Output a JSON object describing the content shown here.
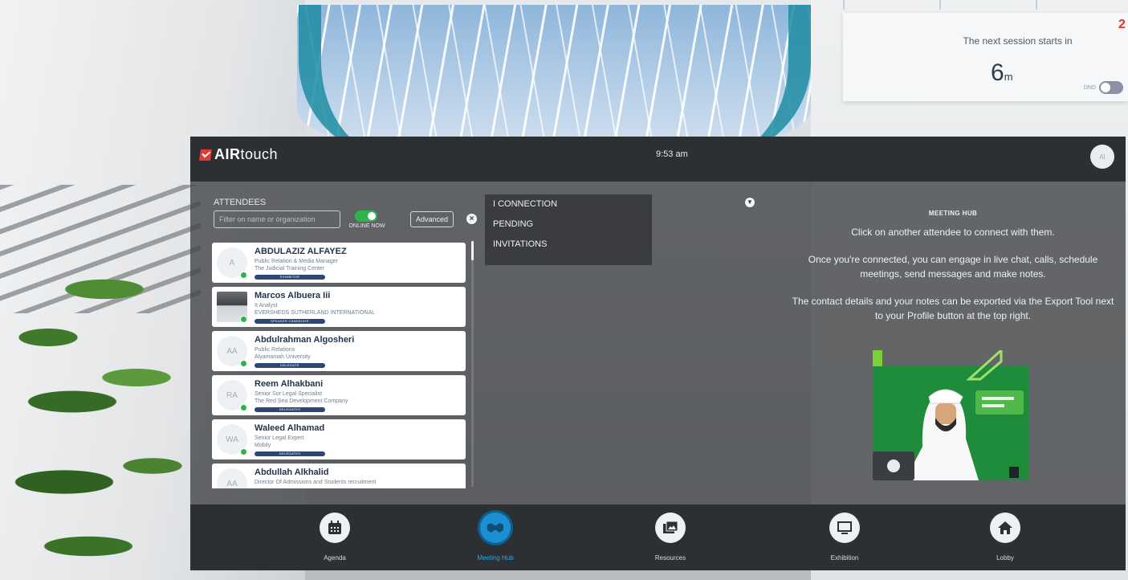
{
  "next_session": {
    "label": "The next session starts in",
    "value": "6",
    "unit": "m",
    "dnd_label": "DND",
    "dnd_on": false,
    "alert_mark": "2"
  },
  "topbar": {
    "brand_bold": "AIR",
    "brand_rest": "touch",
    "time": "9:53 am",
    "avatar_initials": "AI"
  },
  "attendees": {
    "title": "ATTENDEES",
    "filter_placeholder": "Filter on name or organization",
    "online_label": "ONLINE NOW",
    "online_on": true,
    "advanced_label": "Advanced",
    "list": [
      {
        "initials": "A",
        "name": "ABDULAZIZ ALFAYEZ",
        "title": "Public Relation & Media Manager",
        "org": "The Judicial Training Center",
        "tag": "EXHIBITOR",
        "photo": false
      },
      {
        "initials": "",
        "name": "Marcos Albuera Iii",
        "title": "It Analyst",
        "org": "EVERSHEDS SUTHERLAND INTERNATIONAL",
        "tag": "SPEAKER CANDIDATE",
        "photo": true
      },
      {
        "initials": "AA",
        "name": "Abdulrahman Algosheri",
        "title": "Public Relations",
        "org": "Alyamamah University",
        "tag": "DELEGATE",
        "photo": false
      },
      {
        "initials": "RA",
        "name": "Reem Alhakbani",
        "title": "Senior Sor Legal Specialist",
        "org": "The Red Sea Development Company",
        "tag": "DELEGATES",
        "photo": false
      },
      {
        "initials": "WA",
        "name": "Waleed Alhamad",
        "title": "Senior Legal Expert",
        "org": "Mobily",
        "tag": "DELEGATES",
        "photo": false
      },
      {
        "initials": "AA",
        "name": "Abdullah Alkhalid",
        "title": "Director Of Admissions and Students recruitment",
        "org": "",
        "tag": "",
        "photo": false
      }
    ]
  },
  "connections": {
    "items": [
      "I CONNECTION",
      "PENDING",
      "INVITATIONS"
    ]
  },
  "hub": {
    "heading": "MEETING HUB",
    "p1": "Click on another attendee to connect with them.",
    "p2": "Once you're connected, you can engage in live chat, calls, schedule meetings, send messages and make notes.",
    "p3": "The contact details and your notes can be exported via the Export Tool next to your Profile button at the top right."
  },
  "nav": [
    {
      "label": "Agenda",
      "icon": "calendar-icon",
      "active": false
    },
    {
      "label": "Meeting Hub",
      "icon": "handshake-icon",
      "active": true
    },
    {
      "label": "Resources",
      "icon": "resources-icon",
      "active": false
    },
    {
      "label": "Exhibition",
      "icon": "monitor-icon",
      "active": false
    },
    {
      "label": "Lobby",
      "icon": "home-icon",
      "active": false
    }
  ],
  "colors": {
    "accent": "#1d8fd0",
    "online": "#2eb34a",
    "brand_red": "#e13b36",
    "bar": "#2c3033"
  }
}
